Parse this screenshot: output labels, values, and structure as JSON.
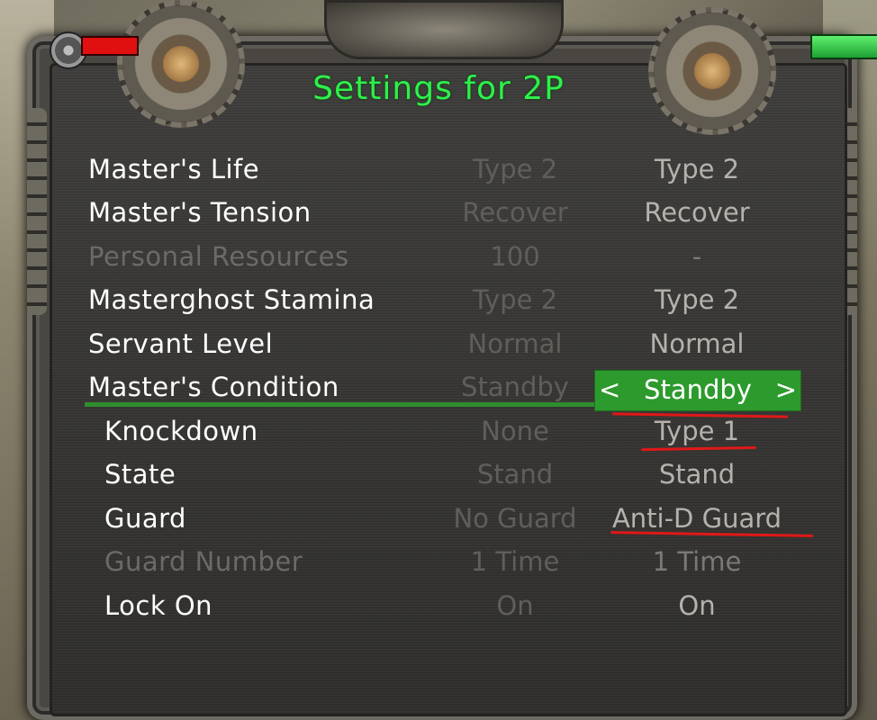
{
  "title": "Settings for 2P",
  "accent_color": "#2ef04a",
  "selected_color": "#2d9a2d",
  "rows": [
    {
      "label": "Master's Life",
      "col1": "Type 2",
      "col2": "Type 2",
      "enabled": true
    },
    {
      "label": "Master's Tension",
      "col1": "Recover",
      "col2": "Recover",
      "enabled": true
    },
    {
      "label": "Personal Resources",
      "col1": "100",
      "col2": "-",
      "enabled": false
    },
    {
      "label": "Masterghost Stamina",
      "col1": "Type 2",
      "col2": "Type 2",
      "enabled": true
    },
    {
      "label": "Servant Level",
      "col1": "Normal",
      "col2": "Normal",
      "enabled": true
    },
    {
      "label": "Master's Condition",
      "col1": "Standby",
      "col2": "Standby",
      "enabled": true,
      "selected": true
    },
    {
      "label": "Knockdown",
      "col1": "None",
      "col2": "Type 1",
      "enabled": true
    },
    {
      "label": "State",
      "col1": "Stand",
      "col2": "Stand",
      "enabled": true
    },
    {
      "label": "Guard",
      "col1": "No Guard",
      "col2": "Anti-D Guard",
      "enabled": true
    },
    {
      "label": "Guard Number",
      "col1": "1 Time",
      "col2": "1 Time",
      "enabled": false
    },
    {
      "label": "Lock On",
      "col1": "On",
      "col2": "On",
      "enabled": true
    }
  ],
  "selector": {
    "left_arrow": "<",
    "right_arrow": ">"
  }
}
